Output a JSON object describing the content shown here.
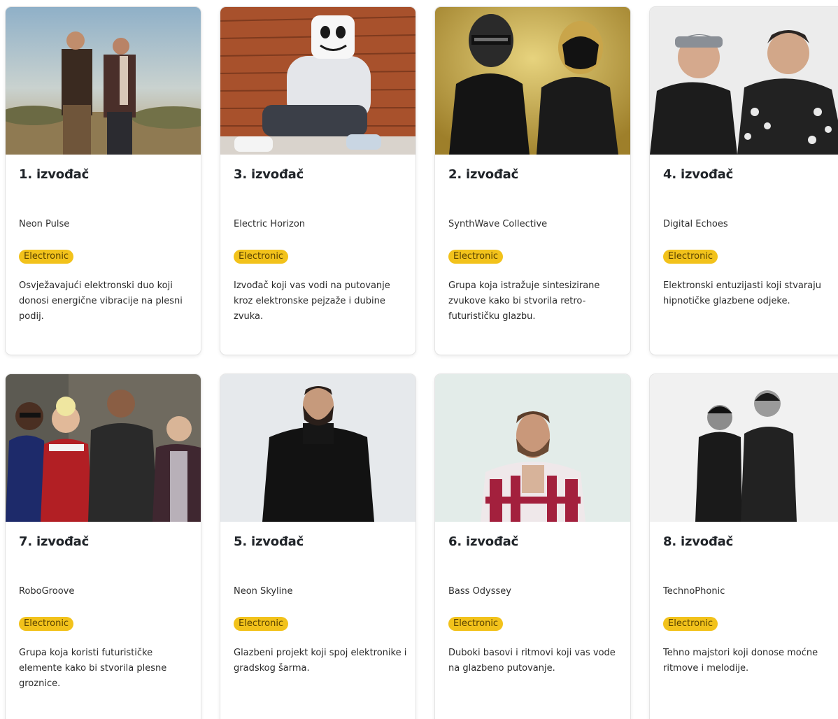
{
  "cards": [
    {
      "title": "1. izvođač",
      "name": "Neon Pulse",
      "genre": "Electronic",
      "description": "Osvježavajući elektronski duo koji donosi energične vibracije na plesni podij.",
      "photo_icon": "duo-desert-photo"
    },
    {
      "title": "3. izvođač",
      "name": "Electric Horizon",
      "genre": "Electronic",
      "description": " Izvođač koji vas vodi na putovanje kroz elektronske pejzaže i dubine zvuka.",
      "photo_icon": "masked-dj-photo"
    },
    {
      "title": "2. izvođač",
      "name": "SynthWave Collective",
      "genre": "Electronic",
      "description": "Grupa koja istražuje sintesizirane zvukove kako bi stvorila retro-futurističku glazbu.",
      "photo_icon": "helmet-duo-photo"
    },
    {
      "title": "4. izvođač",
      "name": "Digital Echoes",
      "genre": "Electronic",
      "description": "Elektronski entuzijasti koji stvaraju hipnotičke glazbene odjeke.",
      "photo_icon": "duo-portrait-photo"
    },
    {
      "title": "7. izvođač",
      "name": "RoboGroove",
      "genre": "Electronic",
      "description": "Grupa koja koristi futurističke elemente kako bi stvorila plesne groznice.",
      "photo_icon": "band-group-photo"
    },
    {
      "title": "5. izvođač",
      "name": "Neon Skyline",
      "genre": "Electronic",
      "description": "Glazbeni projekt koji spoj elektronike i gradskog šarma.",
      "photo_icon": "solo-turtleneck-photo"
    },
    {
      "title": "6. izvođač",
      "name": "Bass Odyssey",
      "genre": "Electronic",
      "description": "Duboki basovi i ritmovi koji vas vode na glazbeno putovanje.",
      "photo_icon": "solo-shirt-photo"
    },
    {
      "title": "8. izvođač",
      "name": "TechnoPhonic",
      "genre": "Electronic",
      "description": "Tehno majstori koji donose moćne ritmove i melodije.",
      "photo_icon": "duo-bw-photo"
    }
  ],
  "colors": {
    "badge_bg": "#f2c21b",
    "badge_text": "#5a4300",
    "title_text": "#1f2328"
  }
}
